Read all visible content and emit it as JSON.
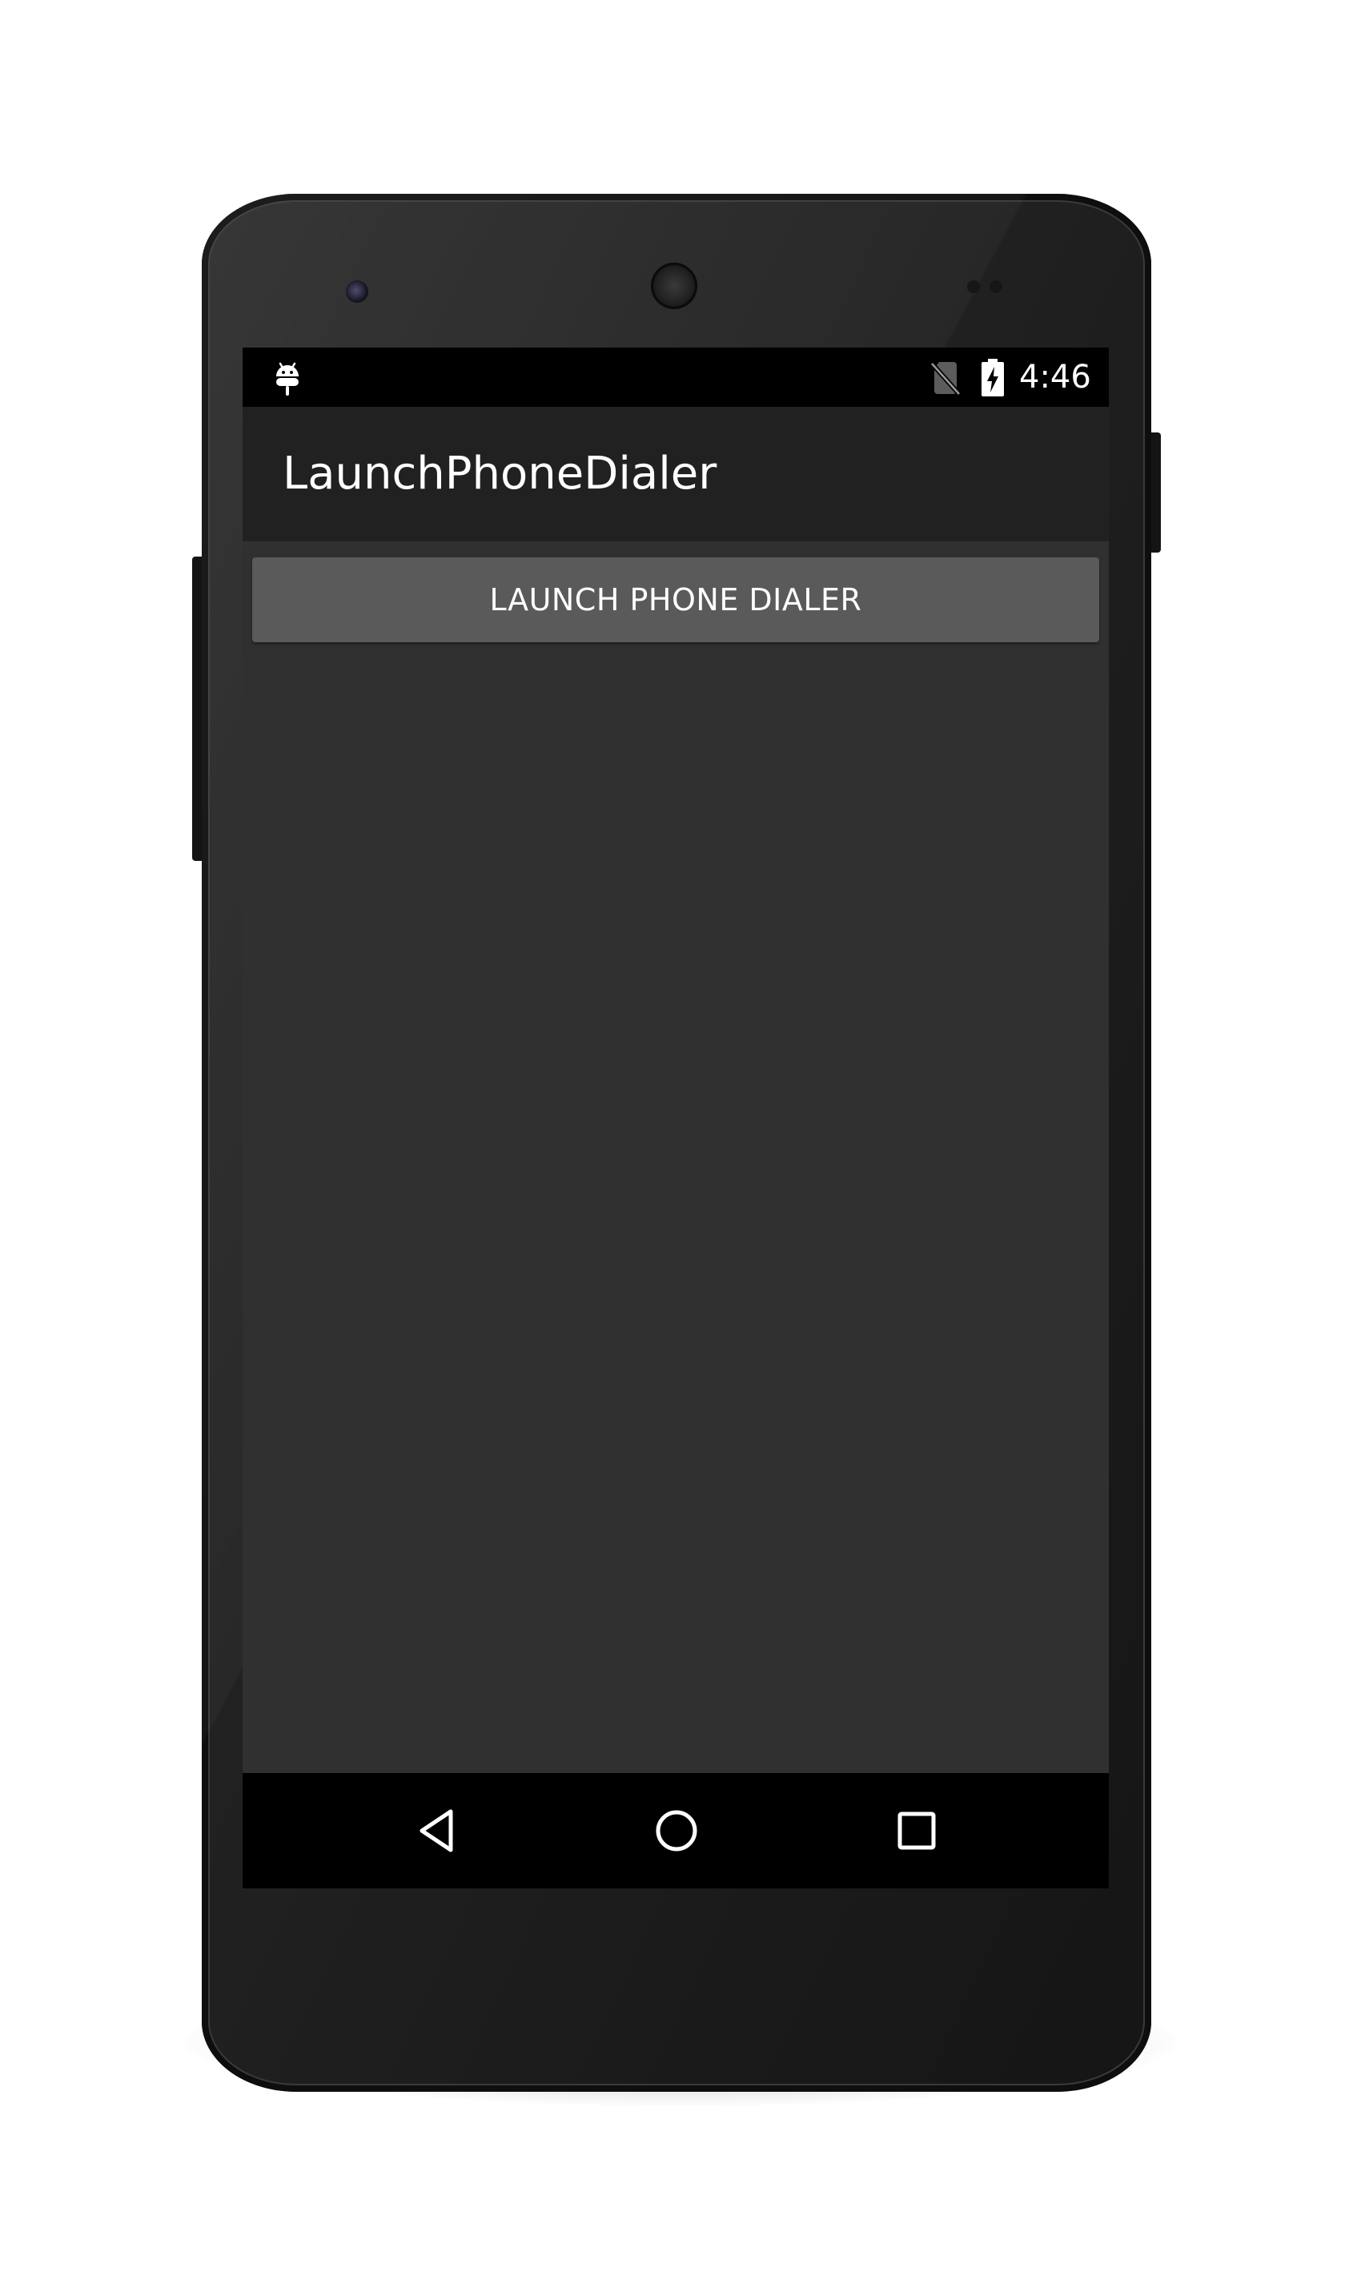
{
  "status_bar": {
    "time": "4:46",
    "icons": [
      "android-debug-icon",
      "no-sim-icon",
      "battery-charging-icon"
    ]
  },
  "app": {
    "title": "LaunchPhoneDialer"
  },
  "main": {
    "launch_button_label": "LAUNCH PHONE DIALER"
  },
  "nav_bar": {
    "buttons": [
      "back-icon",
      "home-icon",
      "recents-icon"
    ]
  },
  "colors": {
    "screen_background": "#303030",
    "action_bar": "#212121",
    "button": "#5a5a5a",
    "status_bar": "#000000",
    "text": "#ffffff"
  }
}
